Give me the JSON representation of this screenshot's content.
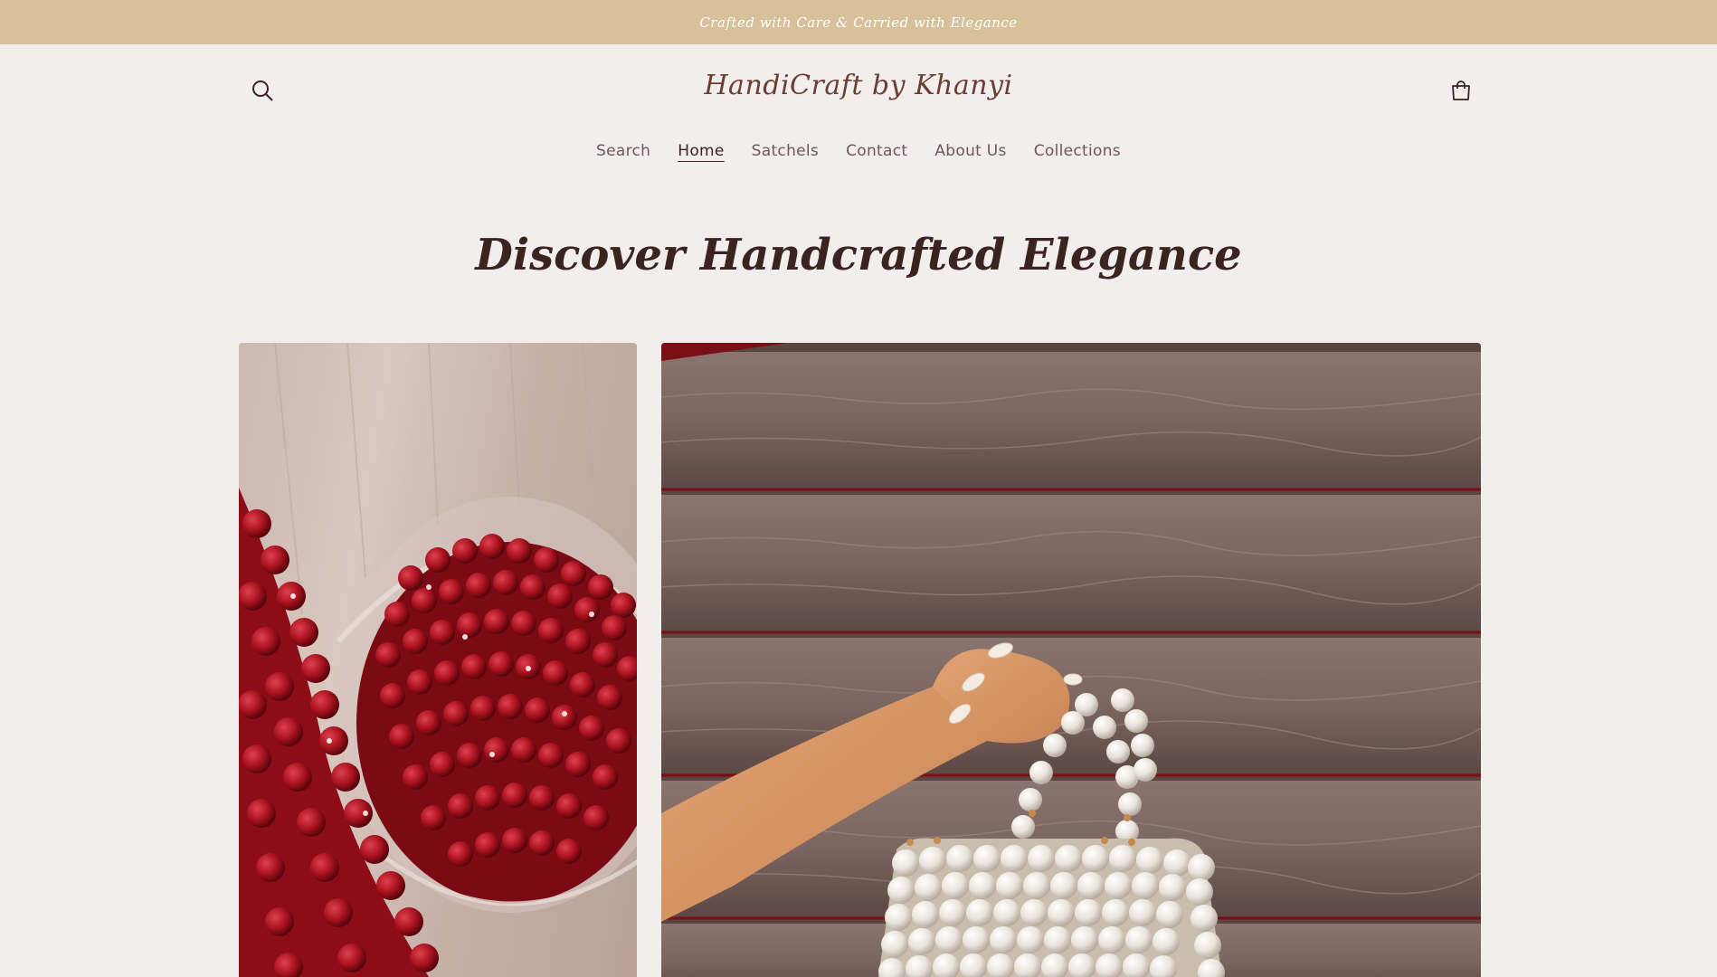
{
  "announcement": {
    "text": "Crafted with Care & Carried with Elegance"
  },
  "header": {
    "logo": "HandiCraft by Khanyi",
    "search_icon": "search-icon",
    "cart_icon": "cart-icon"
  },
  "nav": {
    "items": [
      {
        "label": "Search"
      },
      {
        "label": "Home",
        "active": true
      },
      {
        "label": "Satchels"
      },
      {
        "label": "Contact"
      },
      {
        "label": "About Us"
      },
      {
        "label": "Collections"
      }
    ]
  },
  "hero": {
    "title": "Discover Handcrafted Elegance"
  },
  "colors": {
    "announcement_bg": "#d6c19a",
    "page_bg": "#f1eeed",
    "text_dark": "#3a2320",
    "logo": "#6b3d33"
  }
}
